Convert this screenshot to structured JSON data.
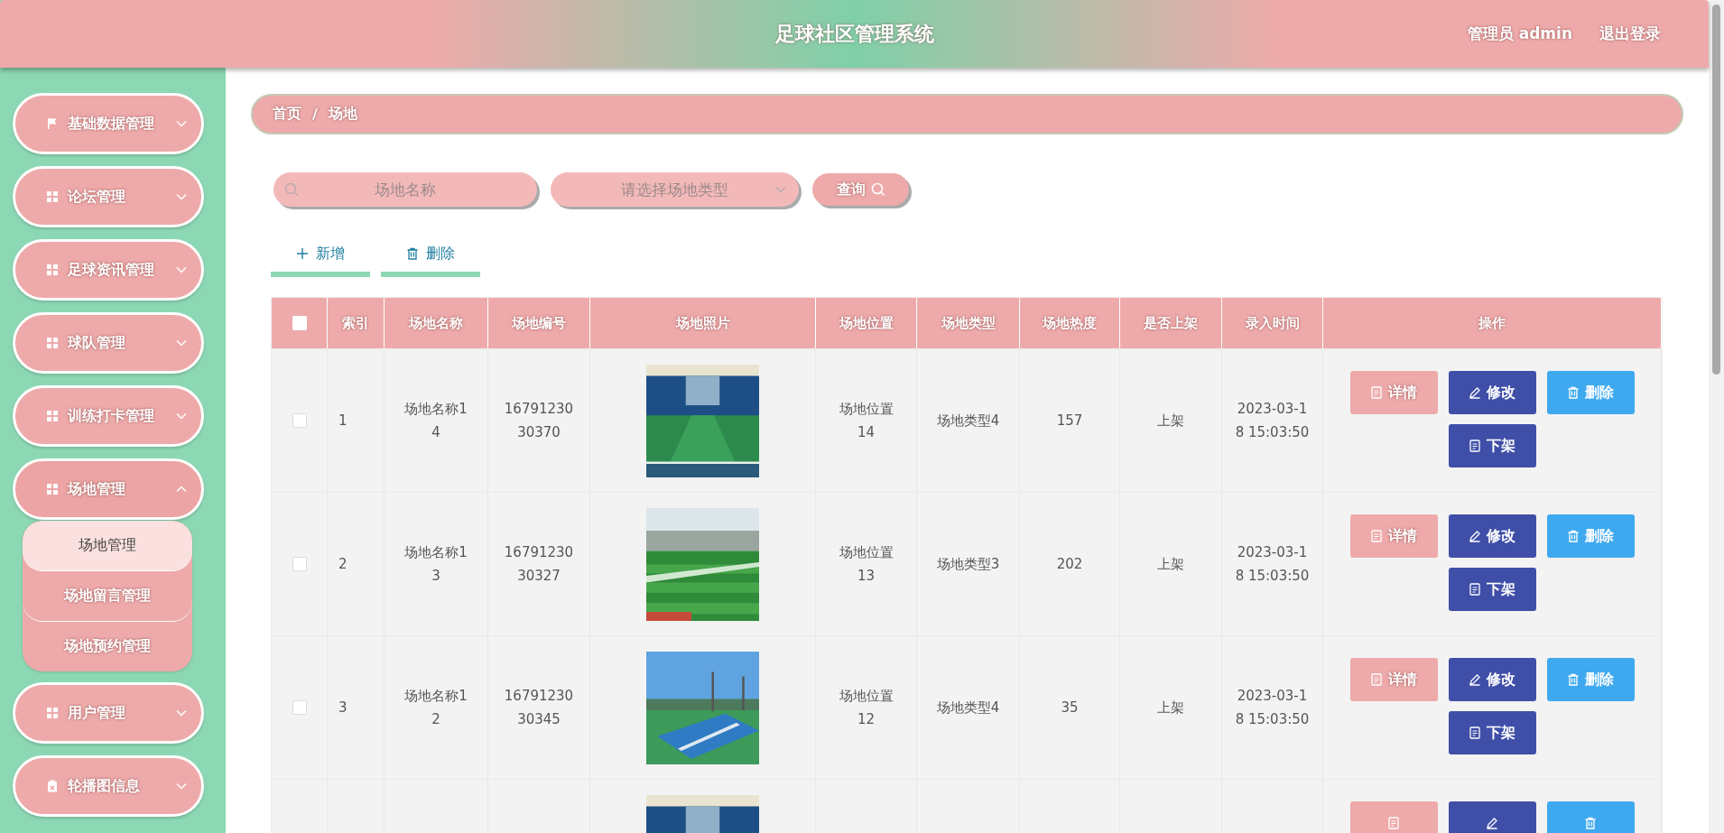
{
  "header": {
    "title": "足球社区管理系统",
    "user": "管理员 admin",
    "logout": "退出登录"
  },
  "sidebar": {
    "items": [
      {
        "label": "基础数据管理",
        "kind": "flag",
        "expanded": false
      },
      {
        "label": "论坛管理",
        "kind": "grid",
        "expanded": false
      },
      {
        "label": "足球资讯管理",
        "kind": "grid",
        "expanded": false
      },
      {
        "label": "球队管理",
        "kind": "grid",
        "expanded": false
      },
      {
        "label": "训练打卡管理",
        "kind": "grid",
        "expanded": false
      },
      {
        "label": "场地管理",
        "kind": "grid",
        "expanded": true,
        "children": [
          {
            "label": "场地管理",
            "selected": true
          },
          {
            "label": "场地留言管理",
            "selected": false
          },
          {
            "label": "场地预约管理",
            "selected": false
          }
        ]
      },
      {
        "label": "用户管理",
        "kind": "grid",
        "expanded": false
      },
      {
        "label": "轮播图信息",
        "kind": "clipboard",
        "expanded": false
      }
    ]
  },
  "breadcrumb": [
    "首页",
    "/",
    "场地"
  ],
  "search": {
    "name_placeholder": "场地名称",
    "type_placeholder": "请选择场地类型",
    "query": "查询"
  },
  "toolbar": [
    {
      "label": "新增",
      "kind": "add"
    },
    {
      "label": "删除",
      "kind": "delete"
    }
  ],
  "table": {
    "all_selected": false,
    "columns": [
      "索引",
      "场地名称",
      "场地编号",
      "场地照片",
      "场地位置",
      "场地类型",
      "场地热度",
      "是否上架",
      "录入时间",
      "操作"
    ],
    "rows": [
      {
        "selected": false,
        "index": "1",
        "name": "场地名称14",
        "code": "1679123030370",
        "location": "场地位置14",
        "type": "场地类型4",
        "heat": "157",
        "listed": "上架",
        "time": "2023-03-18 15:03:50",
        "actions": [
          {
            "kind": "detail",
            "label": "详情"
          },
          {
            "kind": "edit",
            "label": "修改"
          },
          {
            "kind": "delete",
            "label": "删除"
          },
          {
            "kind": "unlist",
            "label": "下架"
          }
        ]
      },
      {
        "selected": false,
        "index": "2",
        "name": "场地名称13",
        "code": "1679123030327",
        "location": "场地位置13",
        "type": "场地类型3",
        "heat": "202",
        "listed": "上架",
        "time": "2023-03-18 15:03:50",
        "actions": [
          {
            "kind": "detail",
            "label": "详情"
          },
          {
            "kind": "edit",
            "label": "修改"
          },
          {
            "kind": "delete",
            "label": "删除"
          },
          {
            "kind": "unlist",
            "label": "下架"
          }
        ]
      },
      {
        "selected": false,
        "index": "3",
        "name": "场地名称12",
        "code": "1679123030345",
        "location": "场地位置12",
        "type": "场地类型4",
        "heat": "35",
        "listed": "上架",
        "time": "2023-03-18 15:03:50",
        "actions": [
          {
            "kind": "detail",
            "label": "详情"
          },
          {
            "kind": "edit",
            "label": "修改"
          },
          {
            "kind": "delete",
            "label": "删除"
          },
          {
            "kind": "unlist",
            "label": "下架"
          }
        ]
      },
      {
        "actions": [
          {
            "kind": "detail"
          },
          {
            "kind": "edit"
          },
          {
            "kind": "delete"
          }
        ]
      }
    ]
  }
}
